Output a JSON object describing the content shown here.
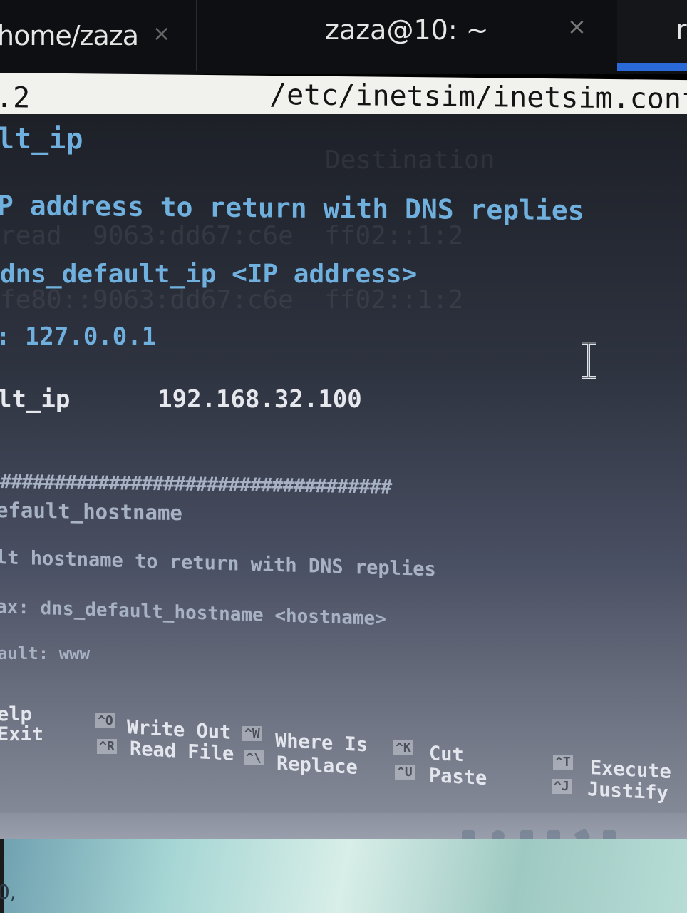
{
  "tabs": [
    {
      "label": "home/zaza",
      "close": "×"
    },
    {
      "label": "zaza@10: ~",
      "close": "×"
    },
    {
      "label": "r"
    }
  ],
  "nano": {
    "version": ".2",
    "filename": "/etc/inetsim/inetsim.conf"
  },
  "config_lines": [
    "lt_ip",
    "P address to return with DNS replies",
    "dns_default_ip <IP address>",
    ": 127.0.0.1",
    "lt_ip      192.168.32.100",
    "####################################",
    "efault_hostname",
    "lt hostname to return with DNS replies",
    "ax: dns_default_hostname <hostname>",
    "ault: www"
  ],
  "background_ghost_text": {
    "heading": "Destination",
    "rows": [
      "read  9063:dd67:c6e  ff02::1:2",
      "fe80::9063:dd67:c6e  ff02::1:2"
    ]
  },
  "shortcuts": [
    {
      "keys": [
        "",
        ""
      ],
      "labels": [
        "elp",
        "Exit"
      ]
    },
    {
      "keys": [
        "^O",
        "^R"
      ],
      "labels": [
        "Write Out",
        "Read File"
      ]
    },
    {
      "keys": [
        "^W",
        "^\\"
      ],
      "labels": [
        "Where Is",
        "Replace"
      ]
    },
    {
      "keys": [
        "^K",
        "^U"
      ],
      "labels": [
        "Cut",
        "Paste"
      ]
    },
    {
      "keys": [
        "^T",
        "^J"
      ],
      "labels": [
        "Execute",
        "Justify"
      ]
    }
  ],
  "desktop": {
    "text": "0,"
  },
  "colors": {
    "accent": "#2a6ad8",
    "comment": "#6fb0de",
    "value": "#e6e8ee"
  }
}
